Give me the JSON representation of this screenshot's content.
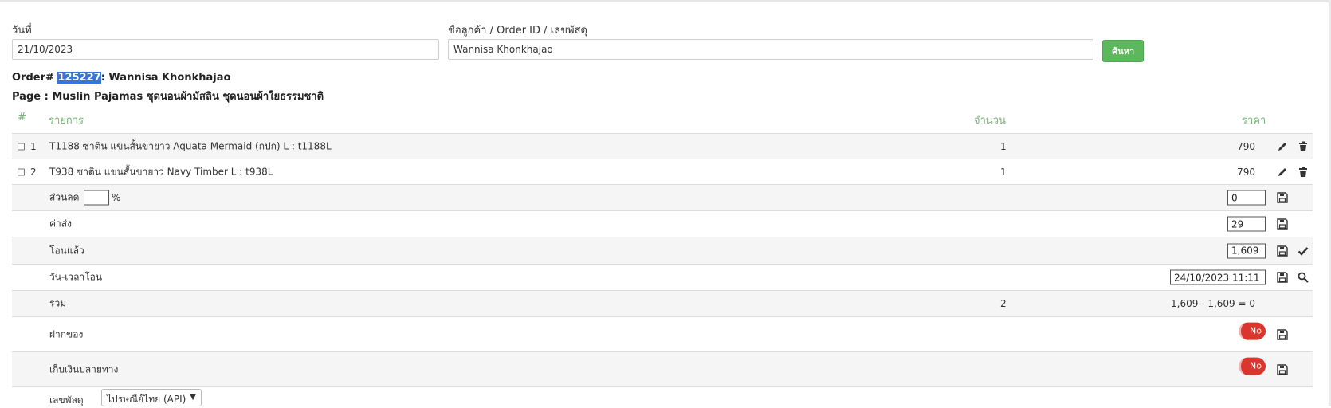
{
  "search": {
    "date_label": "วันที่",
    "date_value": "21/10/2023",
    "query_label": "ชื่อลูกค้า / Order ID / เลขพัสดุ",
    "query_value": "Wannisa Khonkhajao",
    "button_label": "ค้นหา"
  },
  "order": {
    "prefix": "Order# ",
    "id": "125227",
    "customer": ": Wannisa Khonkhajao",
    "page_line": "Page : Muslin Pajamas ชุดนอนผ้ามัสลิน ชุดนอนผ้าใยธรรมชาติ"
  },
  "table": {
    "headers": {
      "num": "#",
      "item": "รายการ",
      "qty": "จำนวน",
      "price": "ราคา"
    },
    "items": [
      {
        "index": "1",
        "name": "T1188 ซาติน แขนสั้นขายาว Aquata Mermaid (กปก) L : t1188L",
        "qty": "1",
        "price": "790"
      },
      {
        "index": "2",
        "name": "T938 ซาติน แขนสั้นขายาว Navy Timber L : t938L",
        "qty": "1",
        "price": "790"
      }
    ],
    "discount": {
      "label": "ส่วนลด",
      "percent_value": "",
      "percent_sign": "%",
      "amount": "0"
    },
    "shipping": {
      "label": "ค่าส่ง",
      "amount": "29"
    },
    "paid": {
      "label": "โอนแล้ว",
      "amount": "1,609"
    },
    "transfer_time": {
      "label": "วัน-เวลาโอน",
      "value": "24/10/2023 11:11"
    },
    "total": {
      "label": "รวม",
      "qty": "2",
      "calc": "1,609 - 1,609 = 0"
    },
    "deposit": {
      "label": "ฝากของ",
      "toggle": "No"
    },
    "cod": {
      "label": "เก็บเงินปลายทาง",
      "toggle": "No"
    },
    "tracking": {
      "label": "เลขพัสดุ",
      "carrier": "ไปรษณีย์ไทย (API)"
    }
  },
  "icons": {
    "edit": "pencil-icon",
    "delete": "trash-icon",
    "save": "floppy-disk-icon",
    "confirm": "check-icon",
    "search": "magnifier-icon",
    "dropdown": "chevron-down-icon"
  },
  "colors": {
    "accent_green": "#5cb85c",
    "header_green": "#74b774",
    "toggle_red": "#d9362f",
    "selection_blue": "#3875d7"
  }
}
